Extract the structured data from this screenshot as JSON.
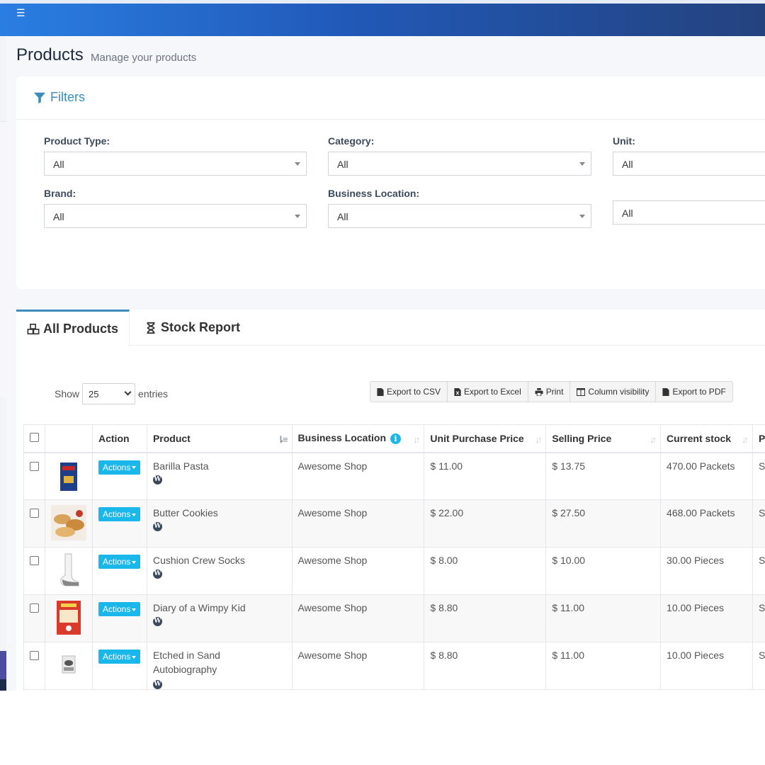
{
  "header": {
    "menu_icon": "hamburger-icon"
  },
  "page": {
    "title": "Products",
    "subtitle": "Manage your products"
  },
  "filters": {
    "title": "Filters",
    "fields": [
      {
        "label": "Product Type:",
        "value": "All"
      },
      {
        "label": "Category:",
        "value": "All"
      },
      {
        "label": "Unit:",
        "value": "All"
      },
      {
        "label": "Brand:",
        "value": "All"
      },
      {
        "label": "Business Location:",
        "value": "All"
      },
      {
        "label": "",
        "value": "All"
      }
    ]
  },
  "tabs": [
    {
      "label": "All Products",
      "icon": "cubes-icon",
      "active": true
    },
    {
      "label": "Stock Report",
      "icon": "hourglass-icon",
      "active": false
    }
  ],
  "table_controls": {
    "show_label": "Show",
    "entries_value": "25",
    "entries_label": "entries",
    "buttons": [
      "Export to CSV",
      "Export to Excel",
      "Print",
      "Column visibility",
      "Export to PDF"
    ]
  },
  "table": {
    "columns": [
      "",
      "",
      "Action",
      "Product",
      "Business Location",
      "Unit Purchase Price",
      "Selling Price",
      "Current stock",
      "P"
    ],
    "action_label": "Actions",
    "rows": [
      {
        "product": "Barilla Pasta",
        "location": "Awesome Shop",
        "purchase": "$ 11.00",
        "selling": "$ 13.75",
        "stock": "470.00 Packets",
        "extra": "S"
      },
      {
        "product": "Butter Cookies",
        "location": "Awesome Shop",
        "purchase": "$ 22.00",
        "selling": "$ 27.50",
        "stock": "468.00 Packets",
        "extra": "S"
      },
      {
        "product": "Cushion Crew Socks",
        "location": "Awesome Shop",
        "purchase": "$ 8.00",
        "selling": "$ 10.00",
        "stock": "30.00 Pieces",
        "extra": "S"
      },
      {
        "product": "Diary of a Wimpy Kid",
        "location": "Awesome Shop",
        "purchase": "$ 8.80",
        "selling": "$ 11.00",
        "stock": "10.00 Pieces",
        "extra": "S"
      },
      {
        "product": "Etched in Sand Autobiography",
        "location": "Awesome Shop",
        "purchase": "$ 8.80",
        "selling": "$ 11.00",
        "stock": "10.00 Pieces",
        "extra": "S"
      }
    ]
  },
  "colors": {
    "accent": "#3c8dbc",
    "action_button": "#1ab7ea",
    "topbar_start": "#2a7de1",
    "topbar_end": "#24427e"
  }
}
